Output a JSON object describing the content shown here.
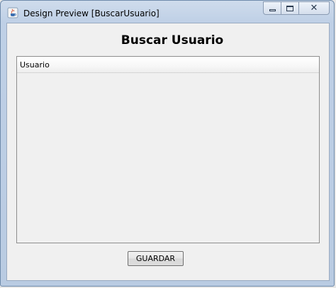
{
  "window": {
    "title": "Design Preview [BuscarUsuario]",
    "app_icon": "java-cup-icon",
    "caption_buttons": {
      "minimize_icon": "minimize-icon",
      "maximize_icon": "maximize-icon",
      "close_icon": "close-icon",
      "close_glyph": "✕"
    }
  },
  "form": {
    "heading": "Buscar Usuario",
    "table": {
      "columns": [
        "Usuario"
      ],
      "rows": []
    },
    "save_label": "GUARDAR"
  },
  "colors": {
    "window_frame": "#b9cbe2",
    "client_background": "#f0f0f0",
    "table_border": "#8e8e8e"
  }
}
